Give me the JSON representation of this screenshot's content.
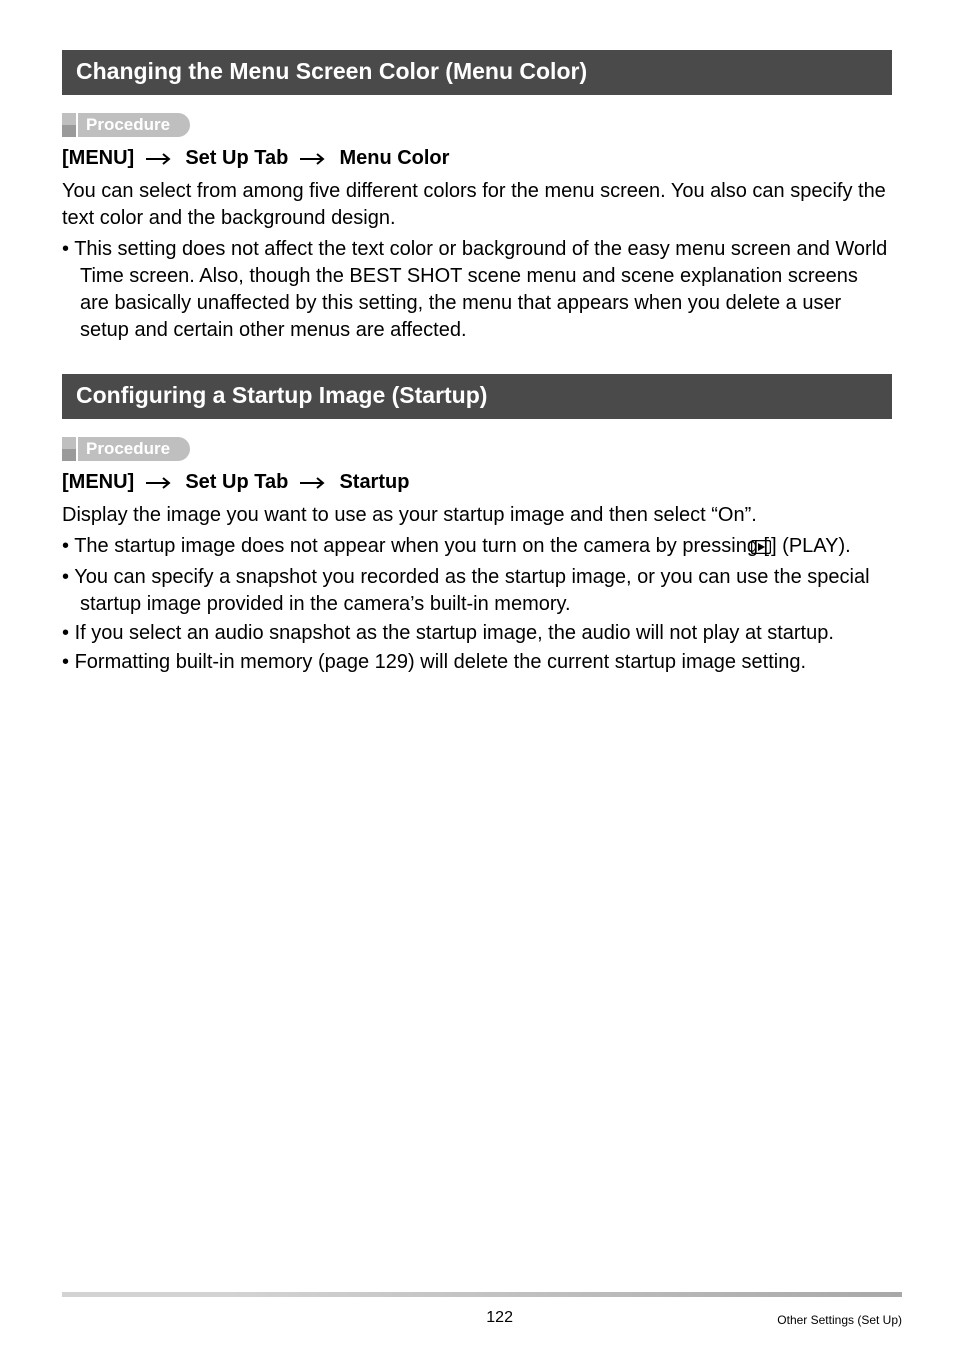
{
  "sections": {
    "s1": {
      "title": "Changing the Menu Screen Color (Menu Color)",
      "procedure_label": "Procedure",
      "nav_prefix": "[MENU]",
      "nav_mid": "Set Up Tab",
      "nav_end": "Menu Color",
      "intro": "You can select from among five different colors for the menu screen. You also can specify the text color and the background design.",
      "bullet1": "This setting does not affect the text color or background of the easy menu screen and World Time screen. Also, though the BEST SHOT scene menu and scene explanation screens are basically unaffected by this setting, the menu that appears when you delete a user setup and certain other menus are affected."
    },
    "s2": {
      "title": "Configuring a Startup Image (Startup)",
      "procedure_label": "Procedure",
      "nav_prefix": "[MENU]",
      "nav_mid": "Set Up Tab",
      "nav_end": "Startup",
      "intro": "Display the image you want to use as your startup image and then select “On”.",
      "bullet1_pre": "The startup image does not appear when you turn on the camera by pressing [",
      "bullet1_post": "] (PLAY).",
      "bullet2": "You can specify a snapshot you recorded as the startup image, or you can use the special startup image provided in the camera’s built-in memory.",
      "bullet3": "If you select an audio snapshot as the startup image, the audio will not play at startup.",
      "bullet4": "Formatting built-in memory (page 129) will delete the current startup image setting."
    }
  },
  "footer": {
    "page": "122",
    "label": "Other Settings (Set Up)"
  }
}
